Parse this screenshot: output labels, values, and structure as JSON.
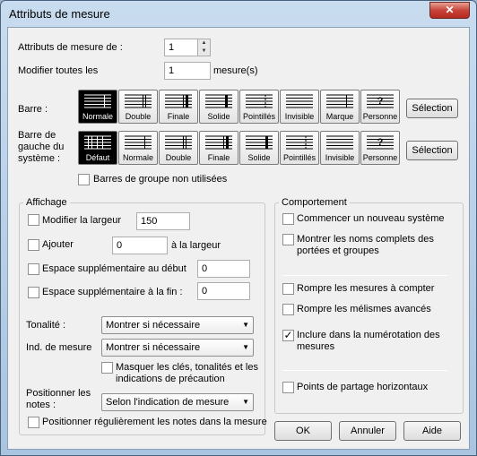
{
  "window": {
    "title": "Attributs de mesure",
    "close_glyph": "✕"
  },
  "measure_of": {
    "label": "Attributs de mesure de :",
    "value": "1"
  },
  "modify_all": {
    "label": "Modifier toutes les",
    "value": "1",
    "suffix": "mesure(s)"
  },
  "barre": {
    "label": "Barre :",
    "buttons": [
      "Normale",
      "Double",
      "Finale",
      "Solide",
      "Pointillés",
      "Invisible",
      "Marque",
      "Personne"
    ],
    "selected": "Normale",
    "selection_button": "Sélection"
  },
  "barre_gauche": {
    "label_line1": "Barre de",
    "label_line2": "gauche du",
    "label_line3": "système :",
    "buttons": [
      "Défaut",
      "Normale",
      "Double",
      "Finale",
      "Solide",
      "Pointillés",
      "Invisible",
      "Personne"
    ],
    "selected": "Défaut",
    "selection_button": "Sélection"
  },
  "group_bars_unused": {
    "label": "Barres de groupe non utilisées",
    "checked": false
  },
  "affichage": {
    "title": "Affichage",
    "modify_width": {
      "label": "Modifier la largeur",
      "value": "150",
      "checked": false
    },
    "add": {
      "label": "Ajouter",
      "value": "0",
      "suffix": "à la largeur",
      "checked": false
    },
    "extra_start": {
      "label": "Espace supplémentaire au début",
      "value": "0",
      "checked": false
    },
    "extra_end": {
      "label": "Espace supplémentaire à la fin :",
      "value": "0",
      "checked": false
    },
    "tonalite": {
      "label": "Tonalité :",
      "value": "Montrer si nécessaire"
    },
    "ind_mesure": {
      "label": "Ind. de mesure",
      "value": "Montrer si nécessaire"
    },
    "hide_courtesy": {
      "line1": "Masquer les clés, tonalités et les",
      "line2": "indications de précaution",
      "checked": false
    },
    "position_notes": {
      "line1": "Positionner les",
      "line2": "notes :",
      "value": "Selon l'indication de mesure"
    },
    "regular_notes": {
      "label": "Positionner régulièrement les notes dans la mesure",
      "checked": false
    }
  },
  "comportement": {
    "title": "Comportement",
    "new_system": {
      "label": "Commencer un nouveau système",
      "checked": false
    },
    "show_full_names": {
      "line1": "Montrer les noms complets des",
      "line2": "portées et groupes",
      "checked": false
    },
    "break_multimeasure": {
      "label": "Rompre les mesures à compter",
      "checked": false
    },
    "break_melisma": {
      "label": "Rompre les mélismes avancés",
      "checked": false
    },
    "include_numbering": {
      "line1": "Inclure dans la numérotation des",
      "line2": "mesures",
      "checked": true
    },
    "split_points": {
      "label": "Points de partage horizontaux",
      "checked": false
    }
  },
  "footer": {
    "ok": "OK",
    "cancel": "Annuler",
    "help": "Aide"
  },
  "glyphs": {
    "check": "✓",
    "arrow": "▼",
    "up": "▲",
    "down": "▼"
  }
}
